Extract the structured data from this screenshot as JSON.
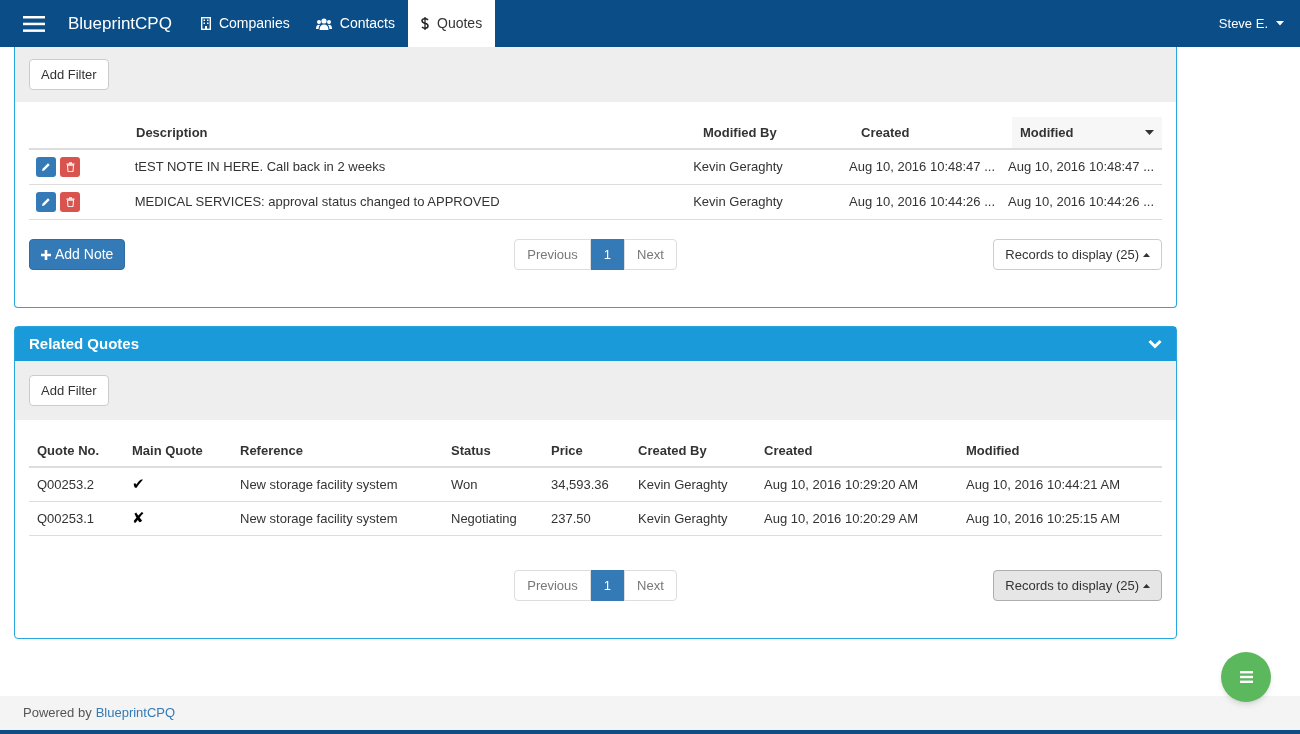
{
  "navbar": {
    "brand": "BlueprintCPQ",
    "tabs": [
      {
        "label": "Companies",
        "selected": false
      },
      {
        "label": "Contacts",
        "selected": false
      },
      {
        "label": "Quotes",
        "selected": true
      }
    ],
    "user": "Steve E."
  },
  "notes": {
    "filter_button": "Add Filter",
    "columns": [
      {
        "label": "Description",
        "sorted": false
      },
      {
        "label": "Modified By",
        "sorted": false
      },
      {
        "label": "Created",
        "sorted": false
      },
      {
        "label": "Modified",
        "sorted": true
      }
    ],
    "rows": [
      {
        "description": "tEST NOTE IN HERE. Call back in 2 weeks",
        "modified_by": "Kevin Geraghty",
        "created": "Aug 10, 2016 10:48:47 ...",
        "modified": "Aug 10, 2016 10:48:47 ..."
      },
      {
        "description": "MEDICAL SERVICES: approval status changed to APPROVED",
        "modified_by": "Kevin Geraghty",
        "created": "Aug 10, 2016 10:44:26 ...",
        "modified": "Aug 10, 2016 10:44:26 ..."
      }
    ],
    "add_button": "Add Note",
    "pagination": {
      "previous": "Previous",
      "pages": [
        {
          "label": "1",
          "selected": true
        }
      ],
      "next": "Next"
    },
    "records_button": {
      "label": "Records to display (25)",
      "active": false
    }
  },
  "related_quotes": {
    "title": "Related Quotes",
    "filter_button": "Add Filter",
    "columns": [
      "Quote No.",
      "Main Quote",
      "Reference",
      "Status",
      "Price",
      "Created By",
      "Created",
      "Modified"
    ],
    "rows": [
      [
        "Q00253.2",
        "✔",
        "New storage facility system",
        "Won",
        "34,593.36",
        "Kevin Geraghty",
        "Aug 10, 2016 10:29:20 AM",
        "Aug 10, 2016 10:44:21 AM"
      ],
      [
        "Q00253.1",
        "✘",
        "New storage facility system",
        "Negotiating",
        "237.50",
        "Kevin Geraghty",
        "Aug 10, 2016 10:20:29 AM",
        "Aug 10, 2016 10:25:15 AM"
      ]
    ],
    "pagination": {
      "previous": "Previous",
      "pages": [
        {
          "label": "1",
          "selected": true
        }
      ],
      "next": "Next"
    },
    "records_button": {
      "label": "Records to display (25)",
      "active": true
    }
  },
  "footer": {
    "text": "Powered by",
    "link": "BlueprintCPQ"
  }
}
